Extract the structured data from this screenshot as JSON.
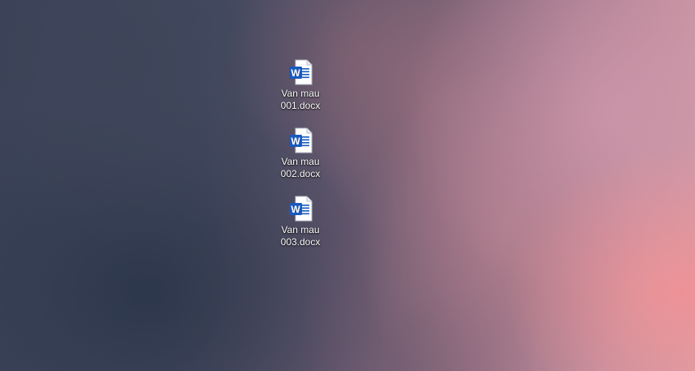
{
  "desktop": {
    "icons": [
      {
        "label": "Van mau 001.docx",
        "icon": "word-document-icon"
      },
      {
        "label": "Van mau 002.docx",
        "icon": "word-document-icon"
      },
      {
        "label": "Van mau 003.docx",
        "icon": "word-document-icon"
      }
    ],
    "colors": {
      "word_blue": "#185ABD",
      "page_white": "#FFFFFF",
      "label_text": "#FFFFFF"
    }
  }
}
